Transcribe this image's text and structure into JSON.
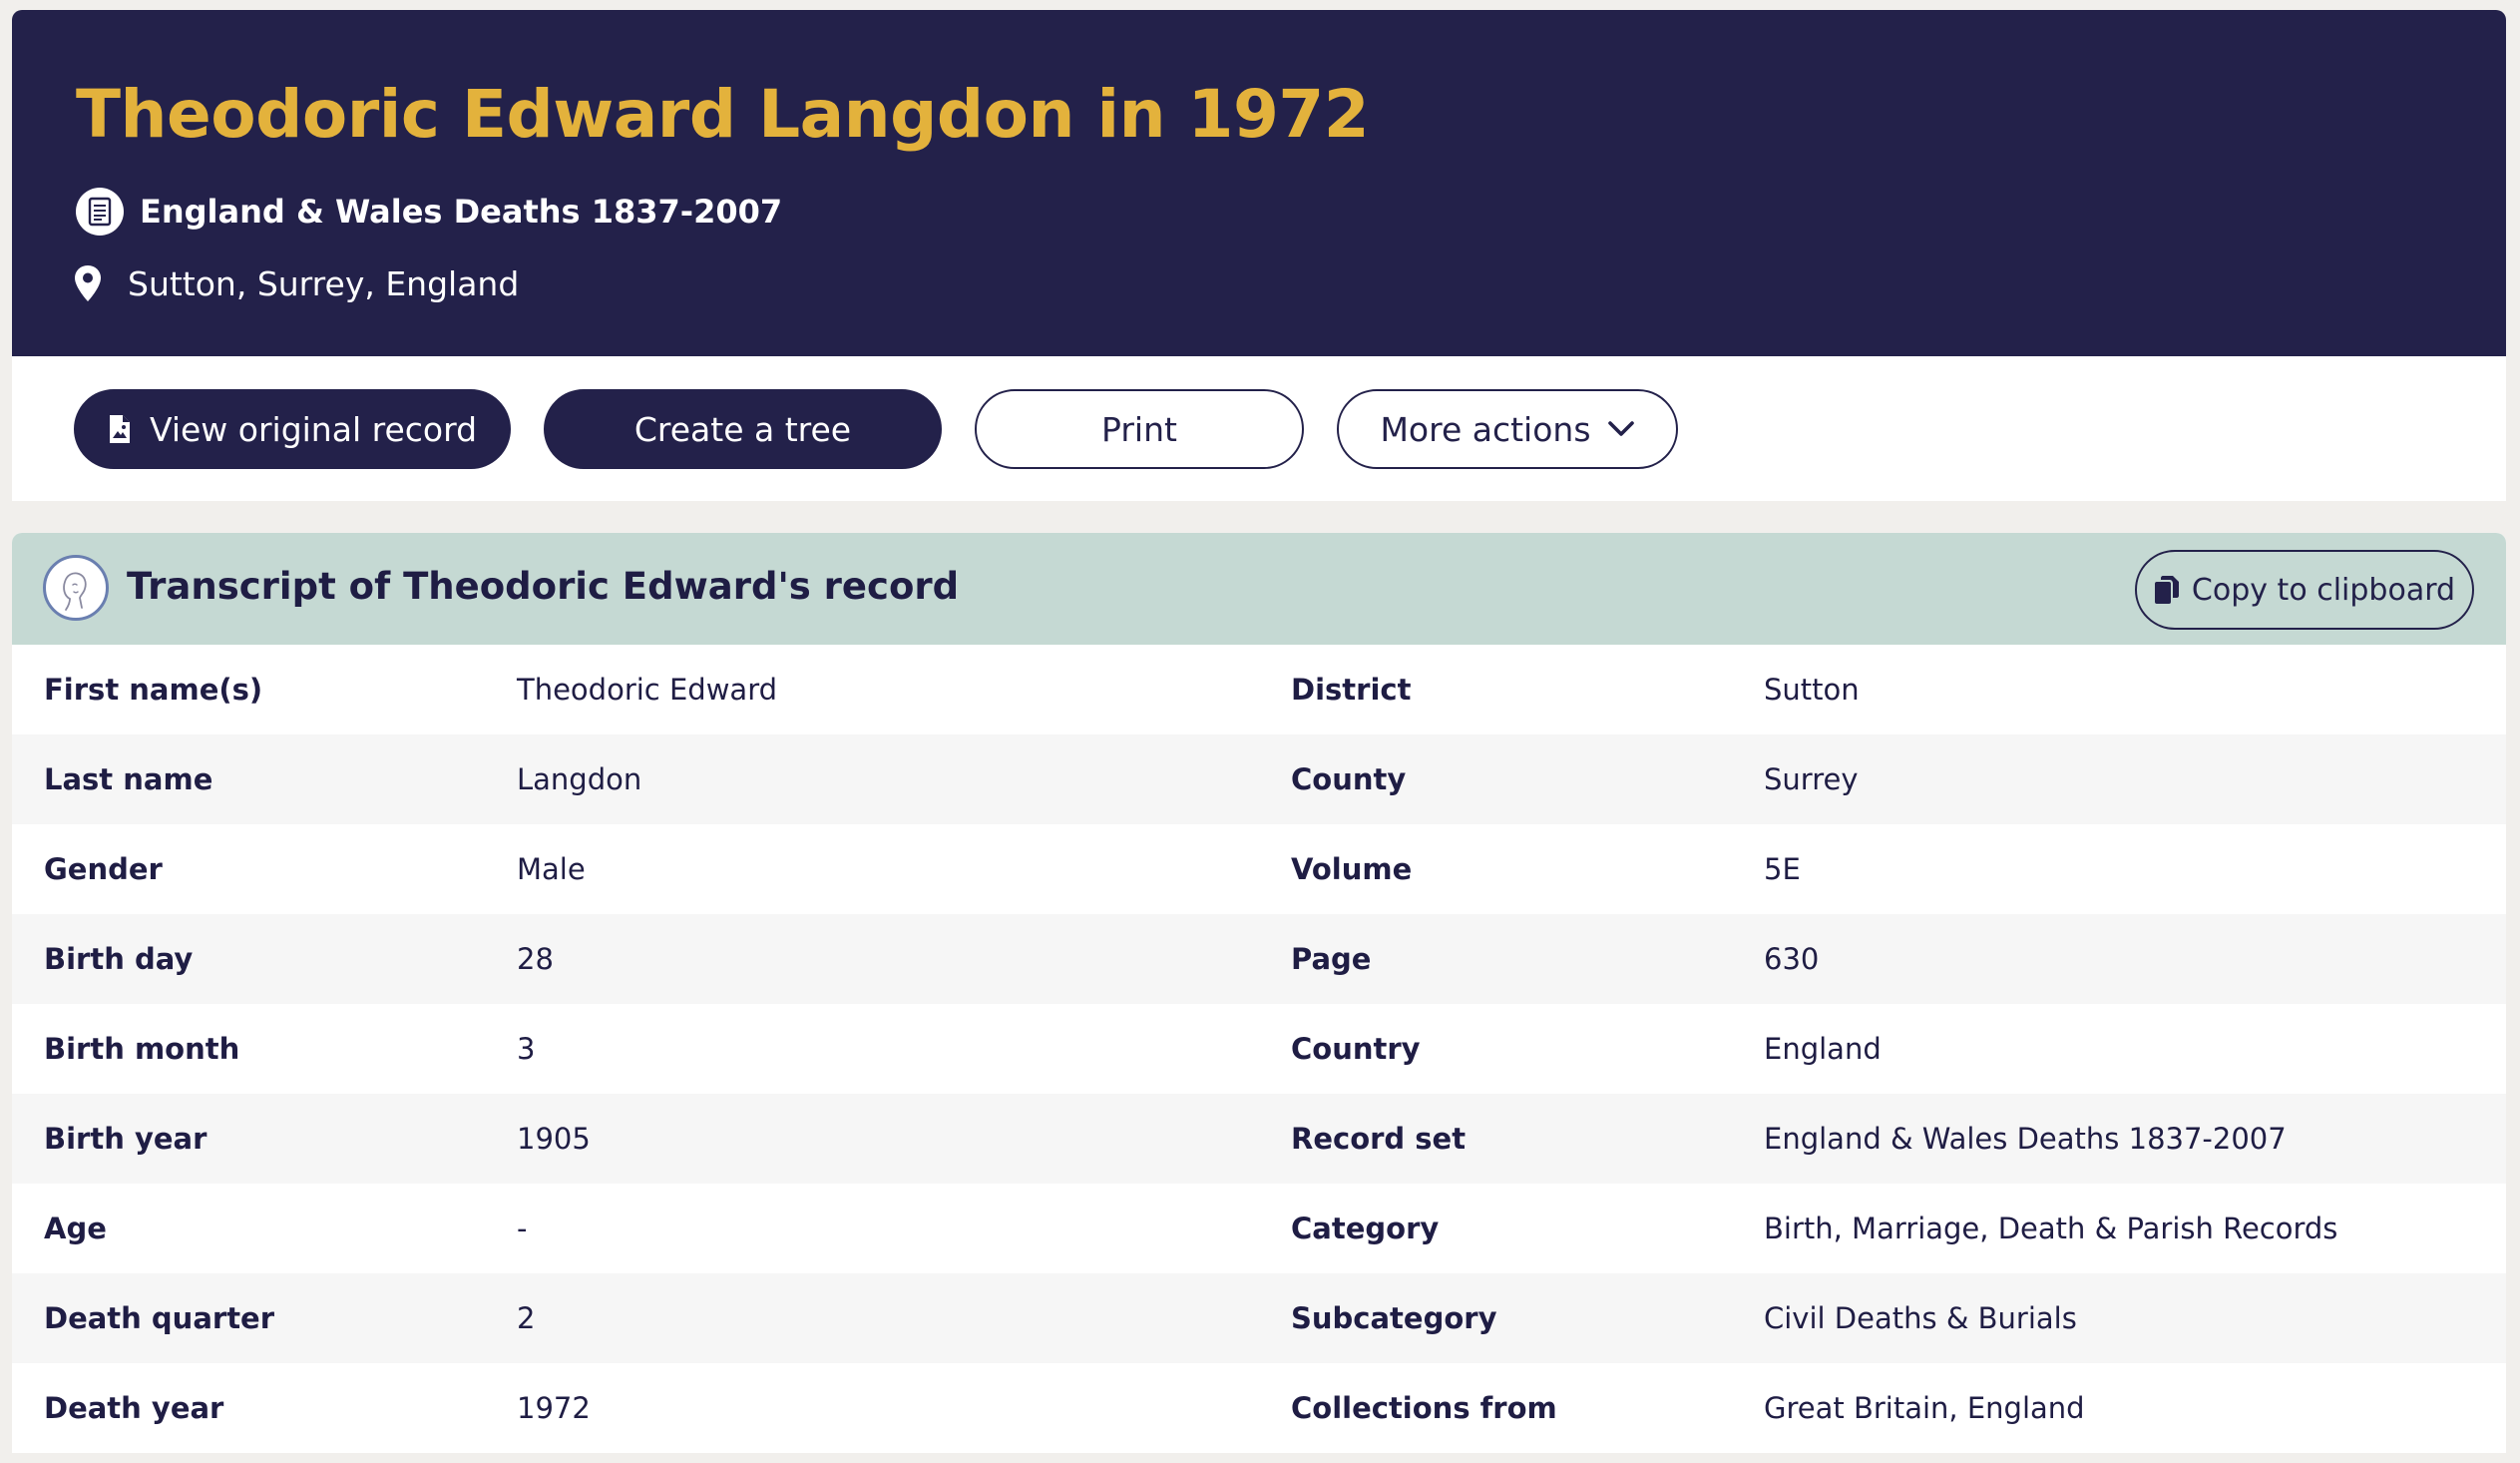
{
  "header": {
    "title": "Theodoric Edward Langdon in 1972",
    "collection": "England & Wales Deaths 1837-2007",
    "location": "Sutton, Surrey, England",
    "title_color": "#e3b23c",
    "background": "#23214a"
  },
  "actions": {
    "view_original": "View original record",
    "create_tree": "Create a tree",
    "print": "Print",
    "more_actions": "More actions"
  },
  "transcript": {
    "title": "Transcript of Theodoric Edward's record",
    "copy_label": "Copy to clipboard",
    "header_color": "#c5d9d3",
    "rows": [
      {
        "label_left": "First name(s)",
        "value_left": "Theodoric Edward",
        "label_right": "District",
        "value_right": "Sutton"
      },
      {
        "label_left": "Last name",
        "value_left": "Langdon",
        "label_right": "County",
        "value_right": "Surrey"
      },
      {
        "label_left": "Gender",
        "value_left": "Male",
        "label_right": "Volume",
        "value_right": "5E"
      },
      {
        "label_left": "Birth day",
        "value_left": "28",
        "label_right": "Page",
        "value_right": "630"
      },
      {
        "label_left": "Birth month",
        "value_left": "3",
        "label_right": "Country",
        "value_right": "England"
      },
      {
        "label_left": "Birth year",
        "value_left": "1905",
        "label_right": "Record set",
        "value_right": "England & Wales Deaths 1837-2007"
      },
      {
        "label_left": "Age",
        "value_left": "-",
        "label_right": "Category",
        "value_right": "Birth, Marriage, Death & Parish Records"
      },
      {
        "label_left": "Death quarter",
        "value_left": "2",
        "label_right": "Subcategory",
        "value_right": "Civil Deaths & Burials"
      },
      {
        "label_left": "Death year",
        "value_left": "1972",
        "label_right": "Collections from",
        "value_right": "Great Britain, England"
      }
    ]
  },
  "icons": {
    "collection": "document-icon",
    "location": "map-pin-icon",
    "view_original": "image-file-icon",
    "more_actions": "chevron-down-icon",
    "transcript": "person-avatar-icon",
    "copy": "clipboard-icon"
  }
}
